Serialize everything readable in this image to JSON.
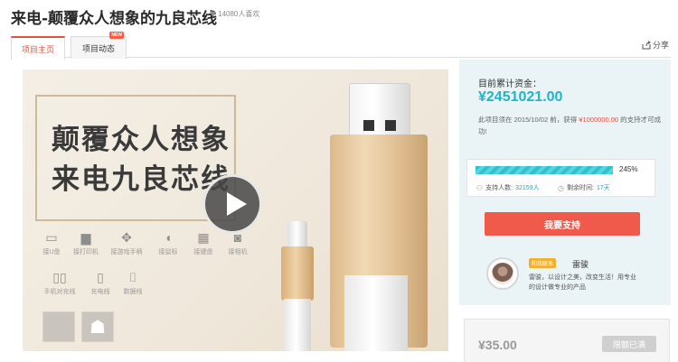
{
  "header": {
    "title": "来电-颠覆众人想象的九良芯线",
    "likes": "14080人喜欢",
    "share_label": "分享"
  },
  "tabs": [
    {
      "label": "项目主页",
      "active": true
    },
    {
      "label": "项目动态",
      "badge": "NEW"
    }
  ],
  "video": {
    "headline_line1": "颠覆众人想象",
    "headline_line2": "来电九良芯线",
    "devices": [
      {
        "icon": "usb-drive-icon",
        "label": "接U盘"
      },
      {
        "icon": "printer-icon",
        "label": "接打印机"
      },
      {
        "icon": "gamepad-icon",
        "label": "接游戏手柄"
      },
      {
        "icon": "mouse-icon",
        "label": "接鼠标"
      },
      {
        "icon": "keyboard-icon",
        "label": "接键盘"
      },
      {
        "icon": "camera-icon",
        "label": "接相机"
      },
      {
        "icon": "phone-icon",
        "label": "手机对充线"
      },
      {
        "icon": "charging-icon",
        "label": "充电线"
      },
      {
        "icon": "cable-icon",
        "label": "数据线"
      }
    ],
    "platforms": [
      "apple-icon",
      "android-icon"
    ]
  },
  "funding": {
    "raised_label": "目前累计资金：",
    "raised_amount": "¥2451021.00",
    "deadline_prefix": "此项目须在 2015/10/02 前，获得 ",
    "goal": "¥1000000.00",
    "deadline_suffix": " 的支持才可成功!",
    "progress_percent": 245,
    "progress_text": "245%",
    "supporters_label": "支持人数:",
    "supporters_value": "32159人",
    "remaining_label": "剩余时间:",
    "remaining_value": "17天",
    "support_button": "我要支持"
  },
  "creator": {
    "tag": "和我联系",
    "name": "雷骏",
    "bio": "雷骏，以设计之美，改变生活！用专业的设计做专业的产品"
  },
  "reward": {
    "price": "¥35.00",
    "status_button": "限额已满"
  },
  "colors": {
    "accent_red": "#f05a4a",
    "accent_teal": "#1fb5c6",
    "panel_bg": "#eaf3f6"
  }
}
